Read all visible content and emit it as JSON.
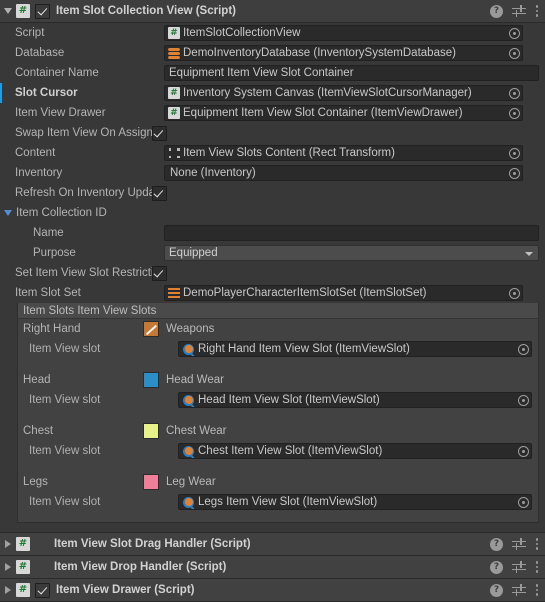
{
  "main_component": {
    "title": "Item Slot Collection View (Script)",
    "enabled": true,
    "script_icon": "csharp-script-icon",
    "help_icon": "help-icon",
    "preset_icon": "preset-icon",
    "menu_icon": "more-menu-icon"
  },
  "fields": {
    "script": {
      "label": "Script",
      "value": "ItemSlotCollectionView",
      "icon": "csharp-script-icon"
    },
    "database": {
      "label": "Database",
      "value": "DemoInventoryDatabase (InventorySystemDatabase)",
      "icon": "scriptable-object-icon"
    },
    "container_name": {
      "label": "Container Name",
      "value": "Equipment Item View Slot Container"
    },
    "slot_cursor": {
      "label": "Slot Cursor",
      "value": "Inventory System Canvas (ItemViewSlotCursorManager)",
      "icon": "csharp-script-icon",
      "overridden": true
    },
    "item_view_drawer": {
      "label": "Item View Drawer",
      "value": "Equipment Item View Slot Container (ItemViewDrawer)",
      "icon": "csharp-script-icon"
    },
    "swap_item_view_on_assign": {
      "label": "Swap Item View On Assign",
      "checked": true
    },
    "content": {
      "label": "Content",
      "value": "Item View Slots Content (Rect Transform)",
      "icon": "rect-transform-icon"
    },
    "inventory": {
      "label": "Inventory",
      "value": "None (Inventory)"
    },
    "refresh_on_inventory_update": {
      "label": "Refresh On Inventory Upda",
      "checked": true
    }
  },
  "item_collection_id": {
    "label": "Item Collection ID",
    "expanded": true,
    "name": {
      "label": "Name",
      "value": ""
    },
    "purpose": {
      "label": "Purpose",
      "value": "Equipped"
    }
  },
  "set_item_view_slot_restriction": {
    "label": "Set Item View Slot Restricti",
    "checked": true
  },
  "item_slot_set": {
    "label": "Item Slot Set",
    "value": "DemoPlayerCharacterItemSlotSet (ItemSlotSet)",
    "icon": "item-slot-set-icon"
  },
  "item_slots": {
    "header": "Item Slots Item View Slots",
    "field_label": "Item View slot",
    "entries": [
      {
        "slot_name": "Right Hand",
        "category": "Weapons",
        "swatch_color": "#c47a35",
        "swatch_kind": "sword",
        "value": "Right Hand Item View Slot (ItemViewSlot)",
        "icon": "item-view-slot-icon"
      },
      {
        "slot_name": "Head",
        "category": "Head Wear",
        "swatch_color": "#2d8dc6",
        "swatch_kind": "solid",
        "value": "Head Item View Slot (ItemViewSlot)",
        "icon": "item-view-slot-icon"
      },
      {
        "slot_name": "Chest",
        "category": "Chest Wear",
        "swatch_color": "#e8f28a",
        "swatch_kind": "solid",
        "value": "Chest Item View Slot (ItemViewSlot)",
        "icon": "item-view-slot-icon"
      },
      {
        "slot_name": "Legs",
        "category": "Leg Wear",
        "swatch_color": "#ef7f98",
        "swatch_kind": "solid",
        "value": "Legs Item View Slot (ItemViewSlot)",
        "icon": "item-view-slot-icon"
      }
    ]
  },
  "other_components": [
    {
      "title": "Item View Slot Drag Handler (Script)",
      "has_checkbox": false,
      "enabled": false
    },
    {
      "title": "Item View Drop Handler (Script)",
      "has_checkbox": false,
      "enabled": false
    },
    {
      "title": "Item View Drawer (Script)",
      "has_checkbox": true,
      "enabled": true
    }
  ],
  "colors": {
    "background": "#383838",
    "header": "#3e3e3e",
    "field": "#2a2a2a",
    "override_marker": "#1f9ce5"
  }
}
